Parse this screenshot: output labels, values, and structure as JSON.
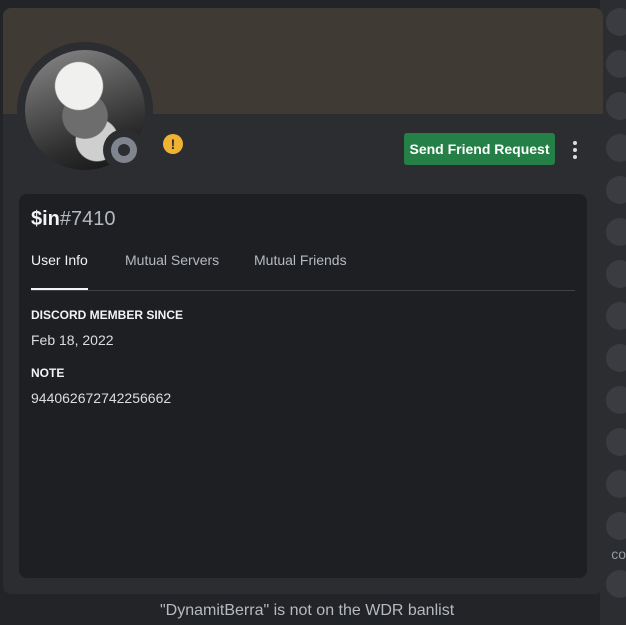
{
  "background": {
    "banlist_text": "\"DynamitBerra\" is not on the WDR banlist",
    "side_text": "co"
  },
  "profile": {
    "banner_color": "#3f3b34",
    "status": "offline",
    "warning_icon": "exclamation-icon",
    "send_friend_request_label": "Send Friend Request",
    "more_icon": "vertical-ellipsis-icon",
    "username": "$in",
    "discriminator": "#7410"
  },
  "tabs": [
    {
      "label": "User Info",
      "active": true
    },
    {
      "label": "Mutual Servers",
      "active": false
    },
    {
      "label": "Mutual Friends",
      "active": false
    }
  ],
  "info": {
    "member_since_title": "DISCORD MEMBER SINCE",
    "member_since_value": "Feb 18, 2022",
    "note_title": "NOTE",
    "note_value": "944062672742256662"
  },
  "colors": {
    "accent_green": "#248046",
    "warning_yellow": "#f0b232",
    "card_bg": "#1e1f22",
    "modal_bg": "#2b2d31"
  }
}
